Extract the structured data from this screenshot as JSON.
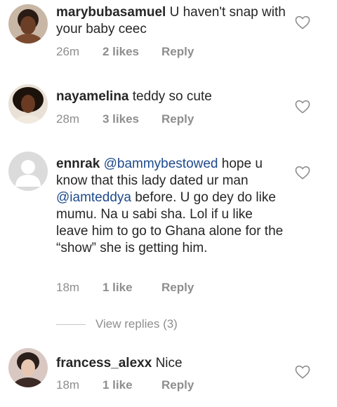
{
  "comments": [
    {
      "username": "marybubasamuel",
      "text": "U haven't snap with your baby ceec",
      "time": "26m",
      "likes": "2 likes",
      "reply": "Reply",
      "avatar_icon": "profile-photo-icon"
    },
    {
      "username": "nayamelina",
      "text": "teddy so cute",
      "time": "28m",
      "likes": "3 likes",
      "reply": "Reply",
      "avatar_icon": "profile-photo-icon"
    },
    {
      "username": "ennrak",
      "mention1": "@bammybestowed",
      "text_part1": "hope u know that this lady dated ur man",
      "mention2": "@iamteddya",
      "text_part2": "before. U go dey do like mumu. Na u sabi sha. Lol if u like leave him to go to Ghana alone for the “show” she is getting him.",
      "time": "18m",
      "likes": "1 like",
      "reply": "Reply",
      "avatar_icon": "default-avatar-icon"
    },
    {
      "username": "francess_alexx",
      "text": "Nice",
      "time": "18m",
      "likes": "1 like",
      "reply": "Reply",
      "avatar_icon": "profile-photo-icon"
    }
  ],
  "view_replies": "View replies (3)",
  "colors": {
    "text": "#262626",
    "meta": "#8e8e8e",
    "mention": "#1e4a8c",
    "default_avatar_bg": "#dbdbdb"
  }
}
